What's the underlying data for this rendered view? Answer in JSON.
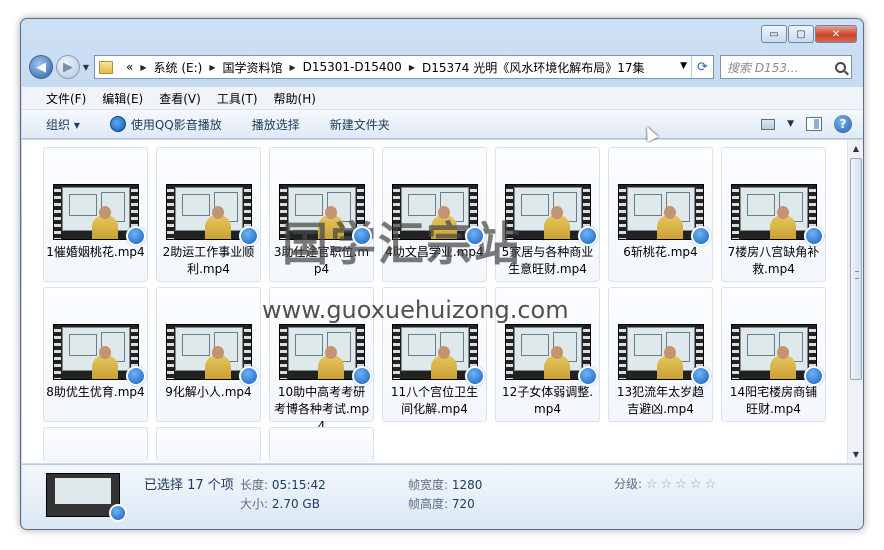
{
  "window": {
    "caption_buttons": {
      "minimize": "▭",
      "maximize": "▢",
      "close": "✕"
    }
  },
  "nav": {
    "back_icon": "◀",
    "forward_icon": "▶",
    "dropdown": "▼"
  },
  "address": {
    "prefix": "«",
    "crumbs": [
      "系统 (E:)",
      "国学资料馆",
      "D15301-D15400",
      "D15374 光明《风水环境化解布局》17集"
    ],
    "dropdown": "▼",
    "refresh": "⟳"
  },
  "search": {
    "placeholder": "搜索 D153..."
  },
  "menubar": [
    "文件(F)",
    "编辑(E)",
    "查看(V)",
    "工具(T)",
    "帮助(H)"
  ],
  "toolbar": {
    "organize": "组织 ▾",
    "play_qq": "使用QQ影音播放",
    "play_selection": "播放选择",
    "new_folder": "新建文件夹",
    "view_dropdown": "▼",
    "help": "?"
  },
  "files": [
    {
      "name": "1催婚姻桃花.mp4"
    },
    {
      "name": "2助运工作事业顺利.mp4"
    },
    {
      "name": "3助仕途官职位.mp4"
    },
    {
      "name": "4助文昌学业.mp4"
    },
    {
      "name": "5家居与各种商业生意旺财.mp4"
    },
    {
      "name": "6斩桃花.mp4"
    },
    {
      "name": "7楼房八宫缺角补救.mp4"
    },
    {
      "name": "8助优生优育.mp4"
    },
    {
      "name": "9化解小人.mp4"
    },
    {
      "name": "10助中高考考研考博各种考试.mp4"
    },
    {
      "name": "11八个宫位卫生间化解.mp4"
    },
    {
      "name": "12子女体弱调整.mp4"
    },
    {
      "name": "13犯流年太岁趋吉避凶.mp4"
    },
    {
      "name": "14阳宅楼房商铺旺财.mp4"
    }
  ],
  "scrollbar": {
    "up": "▲",
    "down": "▼"
  },
  "details": {
    "selected": "已选择 17 个项",
    "length_label": "长度:",
    "length": "05:15:42",
    "size_label": "大小:",
    "size": "2.70 GB",
    "width_label": "帧宽度:",
    "width": "1280",
    "height_label": "帧高度:",
    "height": "720",
    "rating_label": "分级:",
    "rating_stars": "☆☆☆☆☆"
  },
  "watermark": {
    "title": "国学汇宗站",
    "url": "www.guoxuehuizong.com"
  }
}
